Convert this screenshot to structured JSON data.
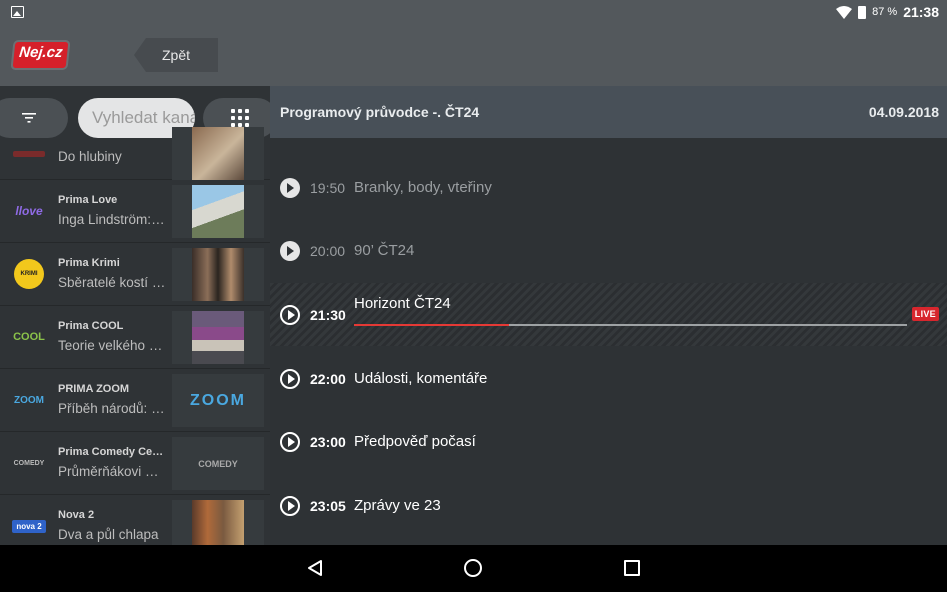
{
  "status_bar": {
    "battery_pct": "87 %",
    "time": "21:38"
  },
  "app_bar": {
    "logo_text": "Nej.cz",
    "back_label": "Zpět"
  },
  "search": {
    "placeholder": "Vyhledat kanál"
  },
  "channels": [
    {
      "name": "",
      "show": "Do hlubiny",
      "logo": "",
      "logo_color": "#c0392b"
    },
    {
      "name": "Prima Love",
      "show": "Inga Lindström: Léto…",
      "logo": "llove",
      "logo_color": "#7b4dd8"
    },
    {
      "name": "Prima Krimi",
      "show": "Sběratelé kostí I…",
      "logo": "KRIMI",
      "logo_color": "#f2c81c"
    },
    {
      "name": "Prima COOL",
      "show": "Teorie velkého třesku",
      "logo": "COOL",
      "logo_color": "#8bc34a"
    },
    {
      "name": "PRIMA ZOOM",
      "show": "Příběh národů: Sla…",
      "logo": "ZOOM",
      "logo_color": "#3aa0d8"
    },
    {
      "name": "Prima Comedy Central",
      "show": "Průměrňákovi V…",
      "logo": "COMEDY",
      "logo_color": "#bbbbbb"
    },
    {
      "name": "Nova 2",
      "show": "Dva a půl chlapa",
      "logo": "nova 2",
      "logo_color": "#2f63c9"
    }
  ],
  "guide": {
    "title": "Programový průvodce -. ČT24",
    "date": "04.09.2018",
    "live_label": "LIVE",
    "live_progress": 0.28,
    "programs": [
      {
        "time": "19:50",
        "title": "Branky, body, vteřiny",
        "state": "past"
      },
      {
        "time": "20:00",
        "title": "90’ ČT24",
        "state": "past"
      },
      {
        "time": "21:30",
        "title": "Horizont ČT24",
        "state": "live"
      },
      {
        "time": "22:00",
        "title": "Události, komentáře",
        "state": "future"
      },
      {
        "time": "23:00",
        "title": "Předpověď počasí",
        "state": "future"
      },
      {
        "time": "23:05",
        "title": "Zprávy ve 23",
        "state": "future"
      }
    ]
  }
}
